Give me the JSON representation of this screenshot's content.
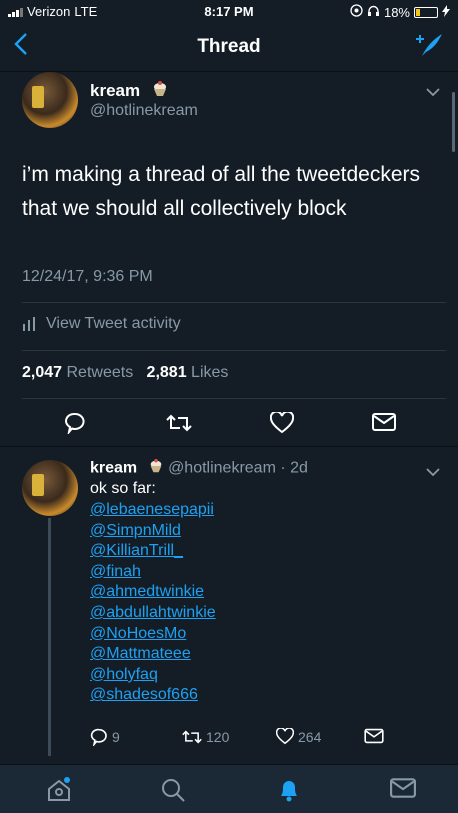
{
  "status_bar": {
    "carrier": "Verizon",
    "network": "LTE",
    "time": "8:17 PM",
    "battery": "18%"
  },
  "nav": {
    "title": "Thread",
    "back_icon": "chevron-left-icon",
    "compose_icon": "compose-feather-icon"
  },
  "main_tweet": {
    "name": "kream",
    "handle": "@hotlinekream",
    "text": "i’m making a thread of all the tweetdeckers that we should all collectively block",
    "timestamp": "12/24/17, 9:36 PM",
    "activity_label": "View Tweet activity",
    "retweets_count": "2,047",
    "retweets_label": "Retweets",
    "likes_count": "2,881",
    "likes_label": "Likes"
  },
  "reply_tweet": {
    "name": "kream",
    "handle": "@hotlinekream",
    "age": "· 2d",
    "intro": "ok so far:",
    "mentions": [
      "@lebaenesepapii",
      "@SimpnMild",
      "@KillianTrill_",
      "@finah",
      "@ahmedtwinkie",
      "@abdullahtwinkie",
      "@NoHoesMo",
      "@Mattmateee",
      "@holyfaq",
      "@shadesof666"
    ],
    "reply_count": "9",
    "retweet_count": "120",
    "like_count": "264"
  },
  "colors": {
    "background": "#141d26",
    "accent": "#1da1f2",
    "secondary_text": "#8899a6",
    "battery": "#f5c518"
  }
}
